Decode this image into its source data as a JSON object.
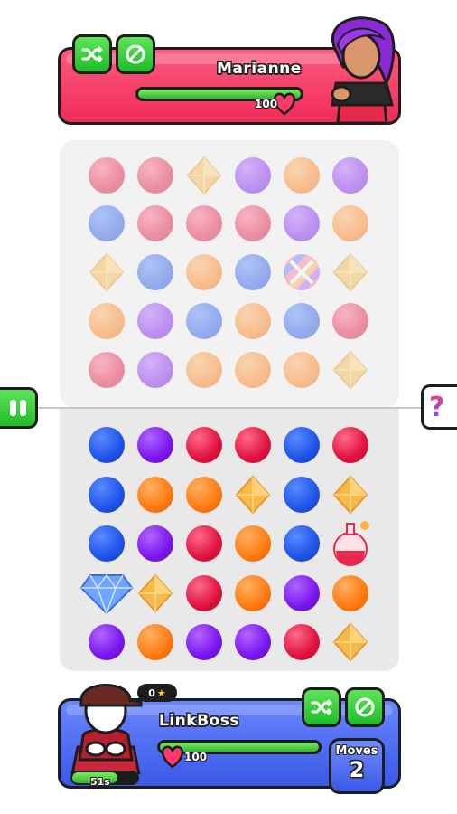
{
  "opponent": {
    "name": "Marianne",
    "hp": "100",
    "hp_fraction": 1.0,
    "avatar_icon": "opponent-avatar-purple-hair",
    "buttons": [
      {
        "icon": "shuffle-icon"
      },
      {
        "icon": "block-icon"
      }
    ]
  },
  "player": {
    "name": "LinkBoss",
    "hp": "100",
    "hp_fraction": 1.0,
    "stars": "0",
    "timer": "51s",
    "timer_fraction": 0.7,
    "moves_label": "Moves",
    "moves_value": "2",
    "avatar_icon": "player-avatar-cap",
    "buttons": [
      {
        "icon": "shuffle-icon"
      },
      {
        "icon": "block-icon"
      }
    ]
  },
  "side": {
    "pause_icon": "pause-icon",
    "help_label": "?"
  },
  "colors": {
    "red": "#e0123e",
    "blue": "#1f53e8",
    "purple": "#7a16ee",
    "orange": "#ff7a10",
    "gold": "#f6b94a",
    "green": "#2fb534",
    "pink_panel": "#ee2c5a",
    "blue_panel": "#3a58e6"
  },
  "board": {
    "opponent_rows": [
      [
        "red",
        "red",
        "gold",
        "purple",
        "orange",
        "purple"
      ],
      [
        "blue",
        "red",
        "red",
        "red",
        "purple",
        "orange"
      ],
      [
        "gold",
        "blue",
        "orange",
        "blue",
        "striped",
        "gold"
      ],
      [
        "orange",
        "purple",
        "blue",
        "orange",
        "blue",
        "red"
      ],
      [
        "red",
        "purple",
        "orange",
        "orange",
        "orange",
        "gold"
      ]
    ],
    "player_rows": [
      [
        "blue",
        "purple",
        "red",
        "red",
        "blue",
        "red"
      ],
      [
        "blue",
        "orange",
        "orange",
        "gold",
        "blue",
        "gold"
      ],
      [
        "blue",
        "purple",
        "red",
        "orange",
        "blue",
        "potion"
      ],
      [
        "diamond",
        "gold",
        "red",
        "orange",
        "purple",
        "orange"
      ],
      [
        "purple",
        "orange",
        "purple",
        "purple",
        "red",
        "gold"
      ]
    ]
  }
}
